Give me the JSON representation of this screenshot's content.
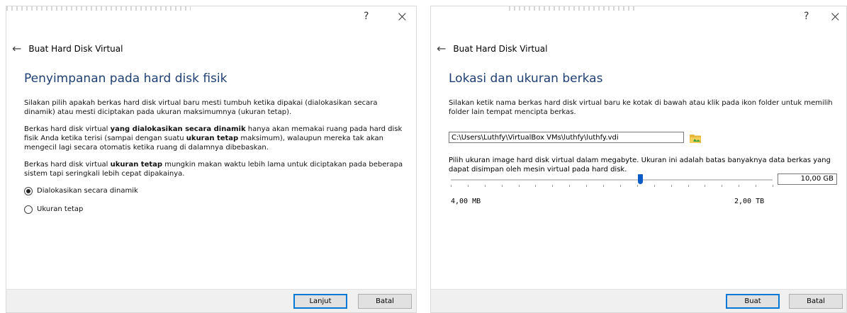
{
  "common": {
    "help": "?",
    "close": "×",
    "back_icon": "back-arrow-icon",
    "header": "Buat Hard Disk Virtual"
  },
  "d1": {
    "title": "Penyimpanan pada hard disk fisik",
    "p1": "Silakan pilih apakah berkas hard disk virtual baru mesti tumbuh ketika dipakai (dialokasikan secara dinamik) atau mesti diciptakan pada ukuran maksimumnya (ukuran tetap).",
    "p2a": "Berkas hard disk virtual ",
    "p2b": "yang dialokasikan secara dinamik",
    "p2c": " hanya akan memakai ruang pada hard disk fisik Anda ketika terisi (sampai dengan suatu ",
    "p2d": "ukuran tetap",
    "p2e": " maksimum), walaupun mereka tak akan mengecil lagi secara otomatis ketika ruang di dalamnya dibebaskan.",
    "p3a": "Berkas hard disk virtual ",
    "p3b": "ukuran tetap",
    "p3c": " mungkin makan waktu lebih lama untuk diciptakan pada beberapa sistem tapi seringkali lebih cepat dipakainya.",
    "options": [
      {
        "label": "Dialokasikan secara dinamik",
        "checked": true
      },
      {
        "label": "Ukuran tetap",
        "checked": false
      }
    ],
    "next": "Lanjut",
    "cancel": "Batal"
  },
  "d2": {
    "title": "Lokasi dan ukuran berkas",
    "p1": "Silakan ketik nama berkas hard disk virtual baru ke kotak di bawah atau klik pada ikon folder untuk memilih folder lain tempat mencipta berkas.",
    "path": "C:\\Users\\Luthfy\\VirtualBox VMs\\luthfy\\luthfy.vdi",
    "p2": "Pilih ukuran image hard disk virtual dalam megabyte. Ukuran ini adalah batas banyaknya data berkas yang dapat disimpan oleh mesin virtual pada hard disk.",
    "size": "10,00 GB",
    "min": "4,00 MB",
    "max": "2,00 TB",
    "create": "Buat",
    "cancel": "Batal"
  }
}
